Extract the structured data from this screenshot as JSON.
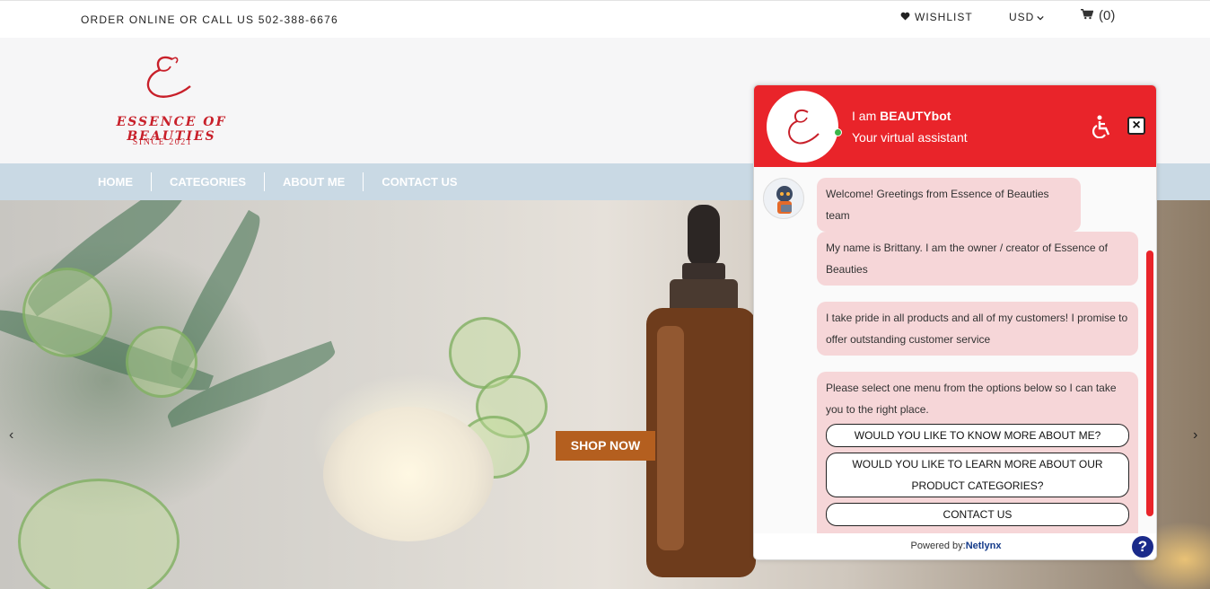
{
  "topbar": {
    "phone_text": "ORDER ONLINE OR CALL US 502-388-6676",
    "wishlist_label": "WISHLIST",
    "currency": "USD",
    "cart_count": "(0)",
    "icons": {
      "wishlist": "heart-icon",
      "currency": "chevron-down-icon",
      "cart": "cart-icon"
    }
  },
  "logo": {
    "brand": "ESSENCE OF BEAUTIES",
    "since": "SINCE 2021",
    "color": "#c8202a"
  },
  "nav": {
    "items": [
      "HOME",
      "CATEGORIES",
      "ABOUT ME",
      "CONTACT US"
    ]
  },
  "hero": {
    "cta_label": "SHOP NOW",
    "cta_color": "#b45f1f",
    "prev_arrow": "‹",
    "next_arrow": "›"
  },
  "chat": {
    "title_prefix": "I am ",
    "title_bot": "BEAUTYbot",
    "subtitle": "Your virtual assistant",
    "header_color": "#e9242a",
    "close_label": "×",
    "messages": [
      "Welcome! Greetings from Essence of Beauties team",
      "My name is Brittany. I am the owner / creator of Essence of Beauties",
      "I take pride in all products and all of my customers! I promise to offer outstanding customer service",
      "Please select one menu from the options below so I can take you to the right place."
    ],
    "options": [
      "WOULD YOU LIKE TO KNOW MORE ABOUT ME?",
      "WOULD YOU LIKE TO LEARN MORE ABOUT OUR PRODUCT CATEGORIES?",
      "CONTACT US"
    ],
    "powered_prefix": "Powered by:",
    "powered_brand": "Netlynx",
    "help_label": "?"
  }
}
